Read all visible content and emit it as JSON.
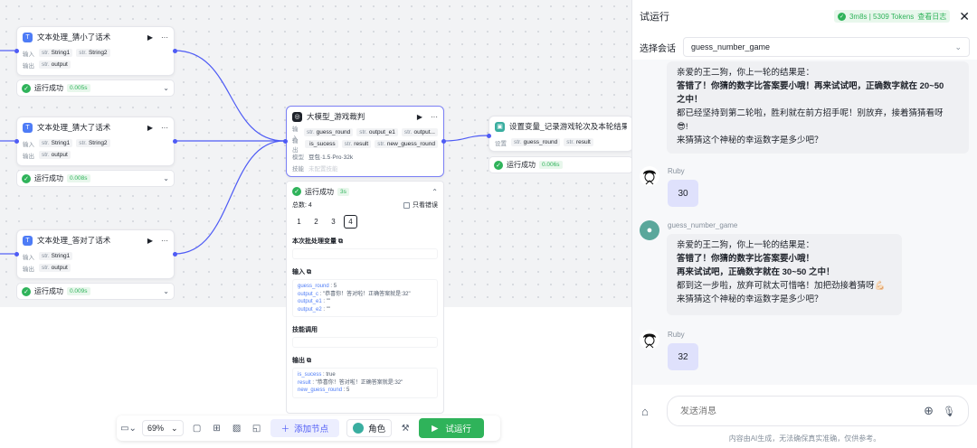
{
  "nodes": {
    "text_small": {
      "title": "文本处理_猜小了话术",
      "in_label": "输入",
      "in_tags": [
        {
          "t": "str.",
          "v": "String1"
        },
        {
          "t": "str.",
          "v": "String2"
        }
      ],
      "out_label": "输出",
      "out_tag": {
        "t": "str.",
        "v": "output"
      },
      "run_text": "运行成功",
      "run_time": "0.005s"
    },
    "text_big": {
      "title": "文本处理_猜大了话术",
      "in_label": "输入",
      "in_tags": [
        {
          "t": "str.",
          "v": "String1"
        },
        {
          "t": "str.",
          "v": "String2"
        }
      ],
      "out_label": "输出",
      "out_tag": {
        "t": "str.",
        "v": "output"
      },
      "run_text": "运行成功",
      "run_time": "0.008s"
    },
    "text_right": {
      "title": "文本处理_答对了话术",
      "in_label": "输入",
      "in_tags": [
        {
          "t": "str.",
          "v": "String1"
        }
      ],
      "out_label": "输出",
      "out_tag": {
        "t": "str.",
        "v": "output"
      },
      "run_text": "运行成功",
      "run_time": "0.009s"
    },
    "llm": {
      "title": "大模型_游戏裁判",
      "in_label": "输入",
      "in_tags": [
        {
          "t": "str.",
          "v": "guess_round"
        },
        {
          "t": "str.",
          "v": "output_e1"
        },
        {
          "t": "str.",
          "v": "output..."
        }
      ],
      "out_label": "输出",
      "out_tags": [
        {
          "t": "",
          "v": "is_sucess"
        },
        {
          "t": "str.",
          "v": "result"
        },
        {
          "t": "str.",
          "v": "new_guess_round"
        }
      ],
      "model_label": "模型",
      "model_value": "豆包·1.5·Pro·32k",
      "skill_label": "技能",
      "skill_value": "未配置技能"
    },
    "setvar": {
      "title": "设置变量_记录游戏轮次及本轮结果",
      "label": "设置",
      "tags": [
        {
          "t": "str.",
          "v": "guess_round"
        },
        {
          "t": "str.",
          "v": "result"
        }
      ],
      "run_text": "运行成功",
      "run_time": "0.006s"
    }
  },
  "panel": {
    "run_text": "运行成功",
    "run_time": "3s",
    "total": "总数: 4",
    "only_error": "只看错误",
    "pages": [
      "1",
      "2",
      "3",
      "4"
    ],
    "batch_title": "本次批处理变量",
    "input_title": "输入",
    "input_lines": [
      {
        "k": "guess_round",
        "v": " : 5"
      },
      {
        "k": "output_c",
        "v": " : \"恭喜你！答对啦！正确答案就是:32\""
      },
      {
        "k": "output_e1",
        "v": " : \"\""
      },
      {
        "k": "output_e2",
        "v": " : \"\""
      }
    ],
    "skill_title": "技能调用",
    "output_title": "输出",
    "output_lines": [
      {
        "k": "is_sucess",
        "v": " : true"
      },
      {
        "k": "result",
        "v": " : \"恭喜你！答对啦！正确答案就是:32\""
      },
      {
        "k": "new_guess_round",
        "v": " : 5"
      }
    ]
  },
  "toolbar": {
    "zoom": "69%",
    "add_node": "添加节点",
    "role": "角色",
    "test_run": "试运行"
  },
  "right": {
    "title": "试运行",
    "status": "3m8s | 5309 Tokens",
    "log_link": "查看日志",
    "session_label": "选择会话",
    "session_value": "guess_number_game",
    "bot_name": "guess_number_game",
    "user_name": "Ruby",
    "msg1": [
      "亲爱的王二狗，你上一轮的结果是：",
      "答错了！你猜的数字比答案要小哦！再来试试吧，正确数字就在 20~50",
      "之中！",
      "都已经坚持到第二轮啦，胜利就在前方招手呢！别放弃，接着猜猜看呀",
      "😎!",
      "来猜猜这个神秘的幸运数字是多少吧？"
    ],
    "user_msg1": "30",
    "msg2": [
      "亲爱的王二狗，你上一轮的结果是：",
      "答错了！你猜的数字比答案要小哦！",
      "再来试试吧，正确数字就在 30~50 之中！",
      "都到这一步啦，放弃可就太可惜咯！加把劲接着猜呀💪🏻",
      "来猜猜这个神秘的幸运数字是多少吧？"
    ],
    "user_msg2": "32",
    "input_placeholder": "发送消息",
    "disclaimer": "内容由AI生成，无法确保真实准确，仅供参考。"
  }
}
